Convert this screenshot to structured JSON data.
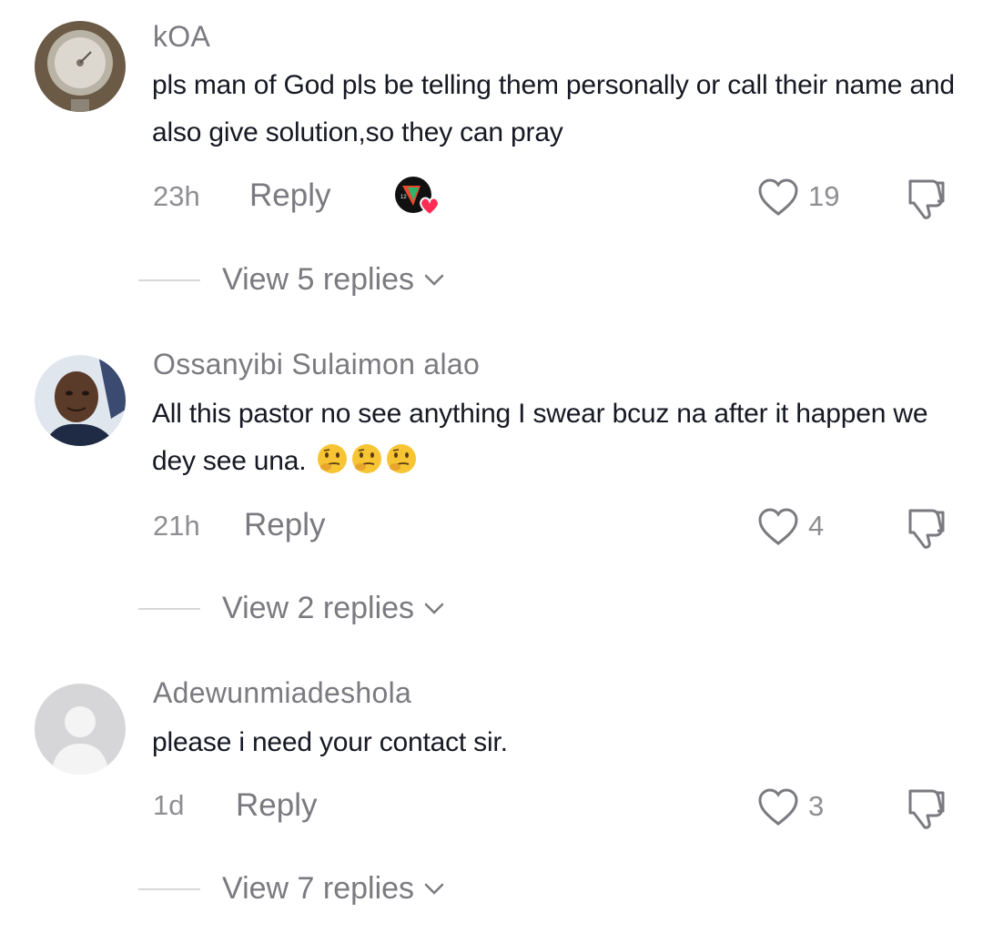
{
  "comments": [
    {
      "username": "kOA",
      "text": "pls man of God pls be telling them personally or call their name and also give solution,so they can pray",
      "time": "23h",
      "reply_label": "Reply",
      "likes": "19",
      "creator_liked": true,
      "view_replies_label": "View 5 replies",
      "avatar_icon": "gauge-photo-avatar"
    },
    {
      "username": "Ossanyibi Sulaimon alao",
      "text": "All this pastor no see anything I swear bcuz na after it happen we dey see una.",
      "emoji": [
        "thinking-face",
        "thinking-face",
        "thinking-face"
      ],
      "time": "21h",
      "reply_label": "Reply",
      "likes": "4",
      "view_replies_label": "View 2 replies",
      "avatar_icon": "person-photo-avatar"
    },
    {
      "username": "Adewunmiadeshola",
      "text": "please i need your contact sir.",
      "time": "1d",
      "reply_label": "Reply",
      "likes": "3",
      "view_replies_label": "View 7 replies",
      "avatar_icon": "default-user-avatar"
    }
  ],
  "colors": {
    "primary_text": "#161823",
    "secondary_text": "#8e8e93",
    "creator_like_heart": "#fe2c55"
  }
}
